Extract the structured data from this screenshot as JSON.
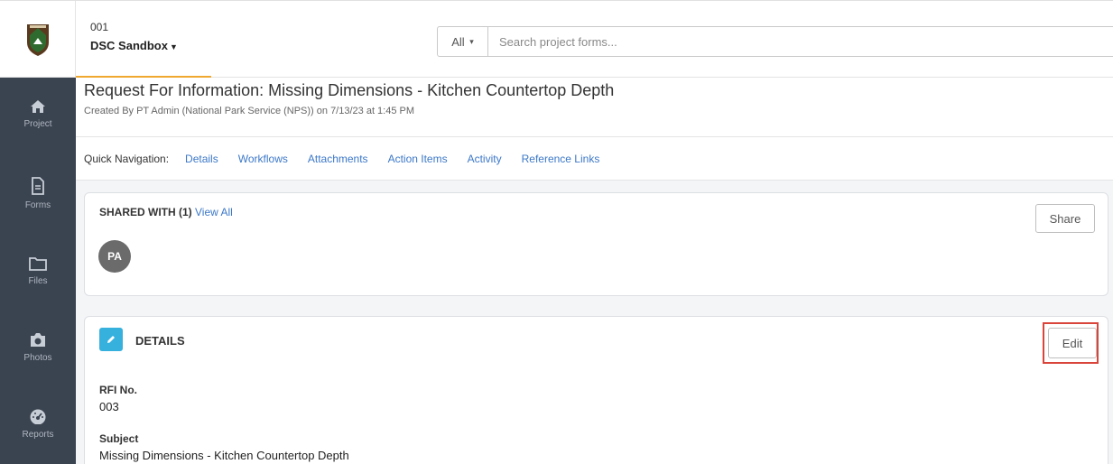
{
  "header": {
    "project_number": "001",
    "project_name": "DSC Sandbox",
    "search_filter": "All",
    "search_placeholder": "Search project forms..."
  },
  "sidebar": {
    "items": [
      {
        "label": "Project",
        "icon": "home-icon"
      },
      {
        "label": "Forms",
        "icon": "document-icon"
      },
      {
        "label": "Files",
        "icon": "folder-icon"
      },
      {
        "label": "Photos",
        "icon": "camera-icon"
      },
      {
        "label": "Reports",
        "icon": "dashboard-icon"
      }
    ]
  },
  "page": {
    "title": "Request For Information: Missing Dimensions - Kitchen Countertop Depth",
    "subtitle": "Created By PT Admin (National Park Service (NPS)) on 7/13/23 at 1:45 PM"
  },
  "quick_nav": {
    "label": "Quick Navigation:",
    "links": [
      "Details",
      "Workflows",
      "Attachments",
      "Action Items",
      "Activity",
      "Reference Links"
    ]
  },
  "shared": {
    "title": "SHARED WITH (1)",
    "view_all": "View All",
    "share_button": "Share",
    "avatar_initials": "PA"
  },
  "details": {
    "title": "DETAILS",
    "edit_button": "Edit",
    "fields": [
      {
        "label": "RFI No.",
        "value": "003"
      },
      {
        "label": "Subject",
        "value": "Missing Dimensions - Kitchen Countertop Depth"
      }
    ]
  },
  "colors": {
    "sidebar_bg": "#3a4350",
    "accent_orange": "#f0a830",
    "link_blue": "#3c78c8",
    "details_icon_bg": "#36b0dd",
    "highlight_red": "#d9453b"
  }
}
